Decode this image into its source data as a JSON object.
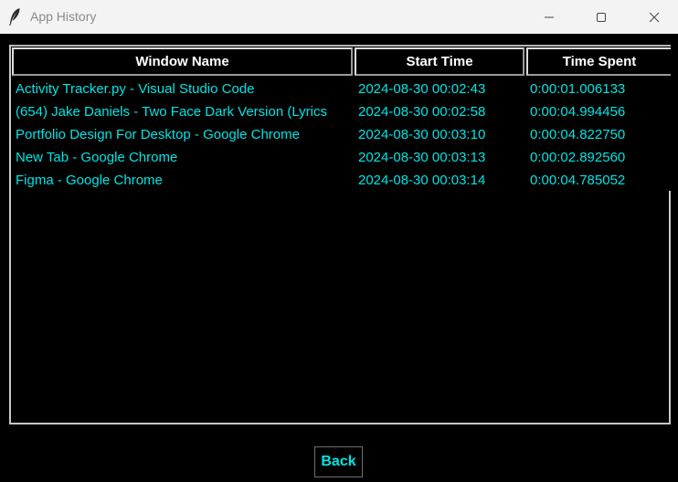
{
  "window": {
    "title": "App History",
    "icon": "feather-icon",
    "controls": [
      "minimize-icon",
      "maximize-icon",
      "close-icon"
    ]
  },
  "table": {
    "columns": [
      "Window Name",
      "Start Time",
      "Time Spent"
    ],
    "rows": [
      [
        "Activity Tracker.py - Visual Studio Code",
        "2024-08-30 00:02:43",
        "0:00:01.006133"
      ],
      [
        "(654) Jake Daniels - Two Face Dark Version (Lyrics",
        "2024-08-30 00:02:58",
        "0:00:04.994456"
      ],
      [
        "Portfolio Design For Desktop - Google Chrome",
        "2024-08-30 00:03:10",
        "0:00:04.822750"
      ],
      [
        "New Tab - Google Chrome",
        "2024-08-30 00:03:13",
        "0:00:02.892560"
      ],
      [
        "Figma - Google Chrome",
        "2024-08-30 00:03:14",
        "0:00:04.785052"
      ]
    ]
  },
  "back_button": {
    "label": "Back"
  },
  "colors": {
    "background": "#000000",
    "text_accent": "#00e5e5",
    "header_text": "#ffffff",
    "titlebar": "#f3f3f3"
  }
}
